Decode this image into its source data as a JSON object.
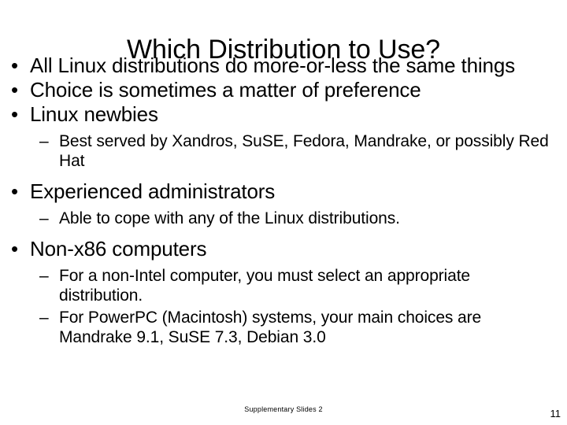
{
  "slide": {
    "title": "Which Distribution to Use?",
    "background_color": "#ffffff",
    "text_color": "#000000",
    "bullet_marker": "•",
    "dash_marker": "–",
    "footer_note": "Supplementary Slides 2",
    "page_number": "11"
  },
  "content": {
    "bullets": [
      {
        "level": 1,
        "text": "All Linux distributions do more-or-less the same things"
      },
      {
        "level": 1,
        "text": "Choice is sometimes a matter of preference"
      },
      {
        "level": 1,
        "text": "Linux newbies"
      },
      {
        "level": 2,
        "text": "Best served by Xandros, SuSE, Fedora, Mandrake, or possibly Red Hat"
      },
      {
        "level": 1,
        "text": "Experienced administrators"
      },
      {
        "level": 2,
        "text": "Able to cope with any of the Linux distributions."
      },
      {
        "level": 1,
        "text": "Non-x86 computers"
      },
      {
        "level": 2,
        "text": "For a non-Intel computer, you must select an appropriate distribution."
      },
      {
        "level": 2,
        "text": "For PowerPC (Macintosh) systems, your main choices are Mandrake 9.1, SuSE 7.3, Debian 3.0"
      }
    ]
  }
}
